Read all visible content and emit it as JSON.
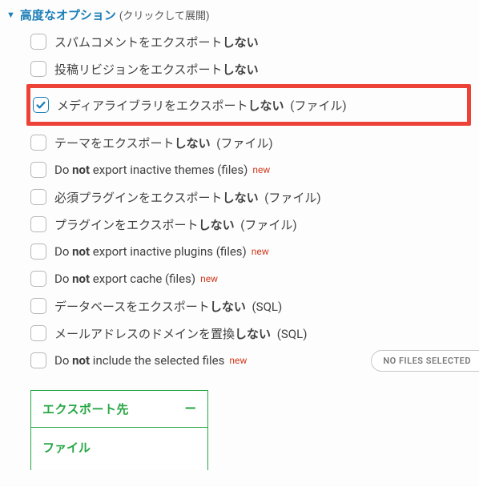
{
  "header": {
    "title": "高度なオプション",
    "hint": "(クリックして展開)"
  },
  "options": [
    {
      "pre": "スパムコメントをエクスポート",
      "bold": "しない",
      "suffix": "",
      "new": false,
      "checked": false,
      "highlight": false
    },
    {
      "pre": "投稿リビジョンをエクスポート",
      "bold": "しない",
      "suffix": "",
      "new": false,
      "checked": false,
      "highlight": false
    },
    {
      "pre": "メディアライブラリをエクスポート",
      "bold": "しない",
      "suffix": " (ファイル)",
      "new": false,
      "checked": true,
      "highlight": true
    },
    {
      "pre": "テーマをエクスポート",
      "bold": "しない",
      "suffix": " (ファイル)",
      "new": false,
      "checked": false,
      "highlight": false
    },
    {
      "pre": "Do ",
      "bold": "not",
      "post": " export inactive themes (files)",
      "suffix": "",
      "new": true,
      "checked": false,
      "highlight": false
    },
    {
      "pre": "必須プラグインをエクスポート",
      "bold": "しない",
      "suffix": " (ファイル)",
      "new": false,
      "checked": false,
      "highlight": false
    },
    {
      "pre": "プラグインをエクスポート",
      "bold": "しない",
      "suffix": " (ファイル)",
      "new": false,
      "checked": false,
      "highlight": false
    },
    {
      "pre": "Do ",
      "bold": "not",
      "post": " export inactive plugins (files)",
      "suffix": "",
      "new": true,
      "checked": false,
      "highlight": false
    },
    {
      "pre": "Do ",
      "bold": "not",
      "post": " export cache (files)",
      "suffix": "",
      "new": true,
      "checked": false,
      "highlight": false
    },
    {
      "pre": "データベースをエクスポート",
      "bold": "しない",
      "suffix": " (SQL)",
      "new": false,
      "checked": false,
      "highlight": false
    },
    {
      "pre": "メールアドレスのドメインを置換",
      "bold": "しない",
      "suffix": " (SQL)",
      "new": false,
      "checked": false,
      "highlight": false
    },
    {
      "pre": "Do ",
      "bold": "not",
      "post": " include the selected files",
      "suffix": "",
      "new": true,
      "checked": false,
      "highlight": false,
      "button": "NO FILES SELECTED"
    }
  ],
  "exportBox": {
    "header": "エクスポート先",
    "body": "ファイル"
  }
}
